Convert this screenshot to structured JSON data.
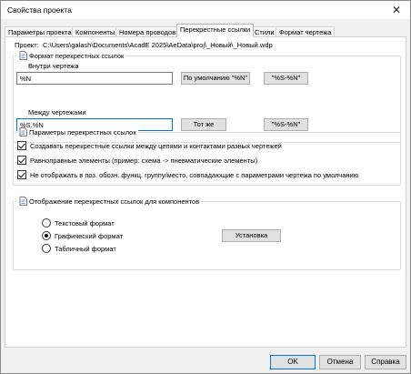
{
  "window": {
    "title": "Свойства проекта",
    "close_symbol": "✕"
  },
  "tabs": [
    {
      "label": "Параметры проекта"
    },
    {
      "label": "Компоненты"
    },
    {
      "label": "Номера проводов"
    },
    {
      "label": "Перекрестные ссылки",
      "active": true
    },
    {
      "label": "Стили"
    },
    {
      "label": "Формат чертежа"
    }
  ],
  "project": {
    "label": "Проект:",
    "path": "C:\\Users\\galash\\Documents\\AcadE 2025\\AeData\\proj\\_Новый\\_Новый.wdp"
  },
  "xref_format": {
    "group_label": "Формат перекрестных ссылок",
    "within_label": "Внутри чертежа",
    "within_value": "%N",
    "default_button": "По умолчанию \"%N\"",
    "s_n_button": "\"%S-%N\"",
    "between_label": "Между чертежами",
    "between_value": "%S.%N",
    "same_button": "Тот же",
    "s_n_button2": "\"%S-%N\""
  },
  "xref_options": {
    "group_label": "Параметры перекрестных ссылок",
    "items": [
      {
        "label": "Создавать перекрестные ссылки между цепями и контактами разных чертежей",
        "checked": true
      },
      {
        "label": "Равноправные элементы (пример: схема -> пневматические элементы)",
        "checked": true
      },
      {
        "label": "Не отображать в поз. обозн. функц. группу/место, совпадающие с параметрами чертежа по умолчанию",
        "checked": true
      }
    ]
  },
  "component_display": {
    "group_label": "Отображение перекрестных ссылок для компонентов",
    "options": [
      {
        "label": "Текстовый формат",
        "selected": false
      },
      {
        "label": "Графический формат",
        "selected": true
      },
      {
        "label": "Табличный формат",
        "selected": false
      }
    ],
    "setup_button": "Установка"
  },
  "footer": {
    "ok": "OK",
    "cancel": "Отмена",
    "help": "Справка"
  }
}
